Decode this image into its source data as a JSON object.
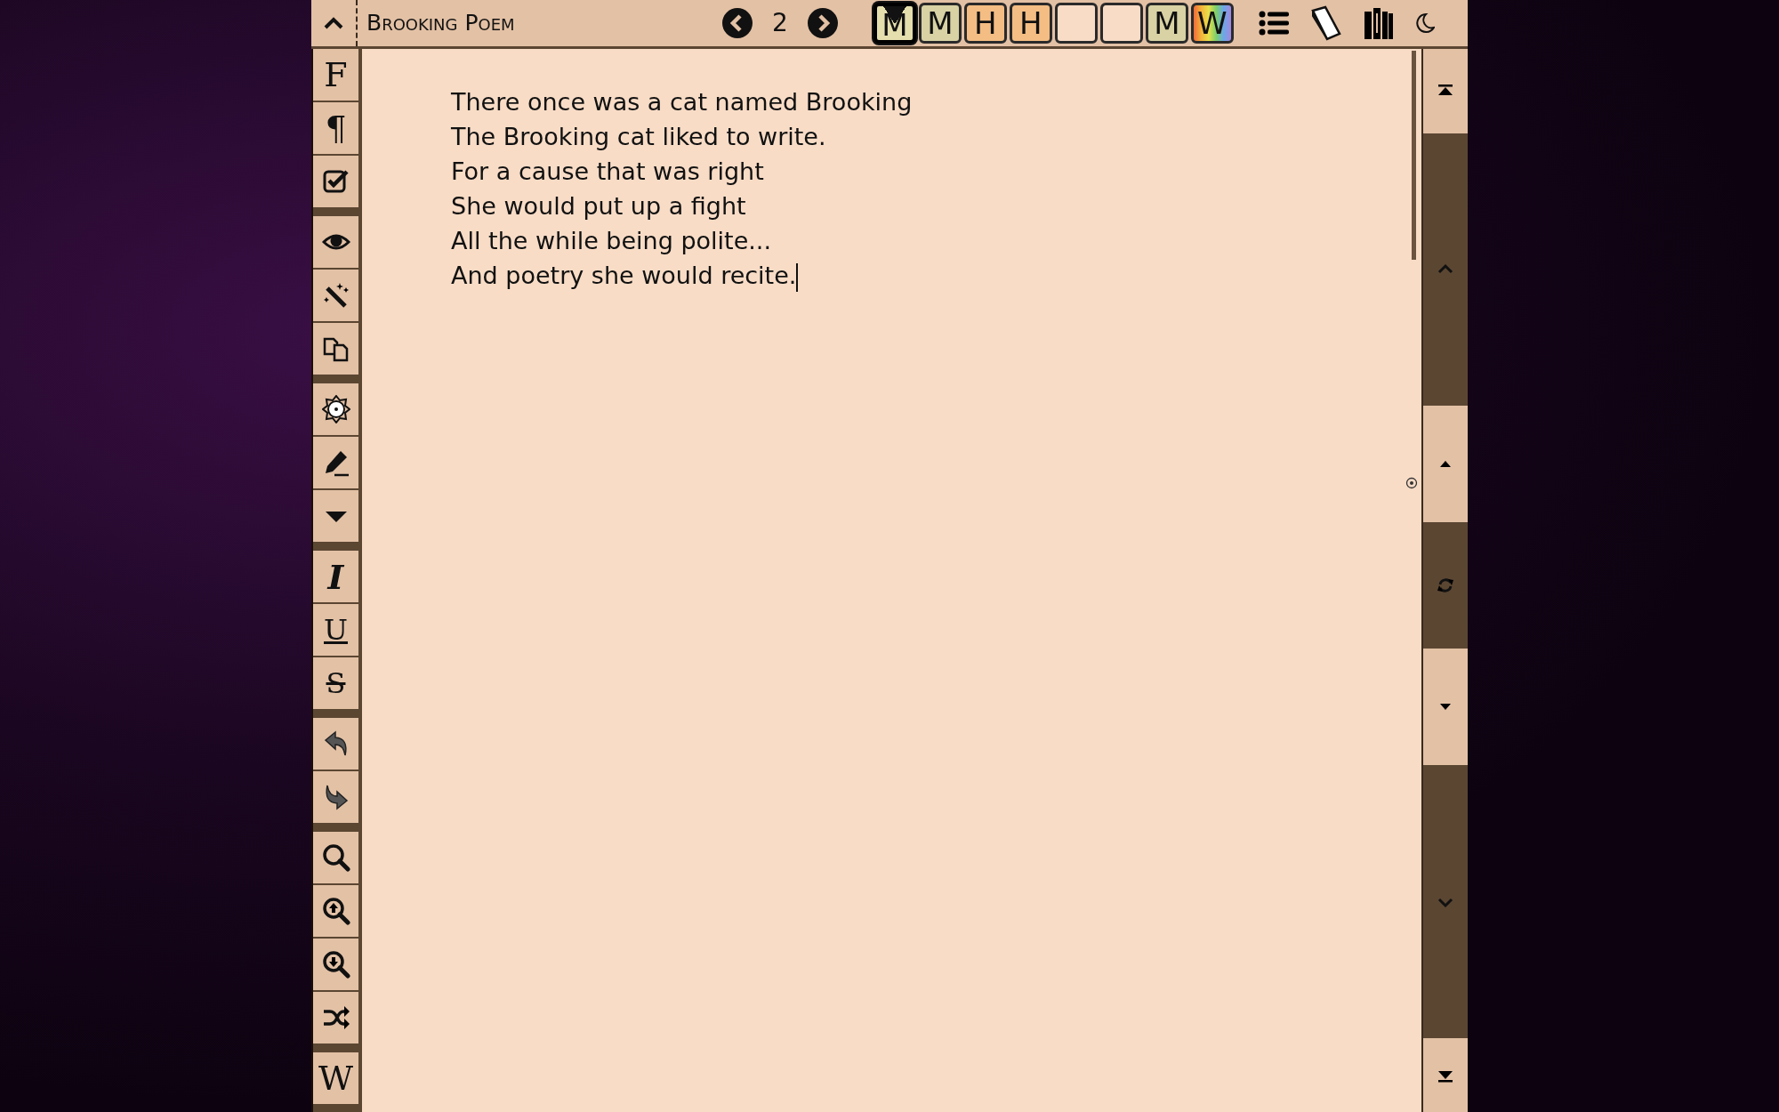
{
  "document": {
    "title": "Brooking Poem",
    "page": "2"
  },
  "level_tiles": [
    {
      "kind": "solid",
      "label": "M",
      "color": "#d8d2a4",
      "selected": true
    },
    {
      "kind": "solid",
      "label": "M",
      "color": "#d8d2a4",
      "selected": false
    },
    {
      "kind": "solid",
      "label": "H",
      "color": "#f4bd83",
      "selected": false
    },
    {
      "kind": "solid",
      "label": "H",
      "color": "#f4bd83",
      "selected": false
    },
    {
      "kind": "solid",
      "color": "#f8dcc6",
      "selected": false
    },
    {
      "kind": "solid",
      "color": "#f8dcc6",
      "selected": false
    },
    {
      "kind": "solid",
      "label": "M",
      "color": "#d8d2a4",
      "selected": false
    },
    {
      "kind": "rainbow",
      "label": "W",
      "selected": false
    }
  ],
  "left_toolbar": [
    {
      "buttons": [
        {
          "kind": "serif",
          "text": "F"
        },
        {
          "kind": "pilcrow",
          "text": "¶"
        },
        {
          "kind": "icon"
        }
      ]
    },
    {
      "buttons": [
        {
          "kind": "icon"
        },
        {
          "kind": "icon"
        },
        {
          "kind": "icon"
        }
      ]
    },
    {
      "buttons": [
        {
          "kind": "icon"
        },
        {
          "kind": "icon"
        },
        {
          "kind": "icon"
        }
      ]
    },
    {
      "buttons": [
        {
          "kind": "italic",
          "text": "I"
        },
        {
          "kind": "underline",
          "text": "U"
        },
        {
          "kind": "strike",
          "text": "S"
        }
      ]
    },
    {
      "buttons": [
        {
          "kind": "icon"
        },
        {
          "kind": "icon"
        }
      ]
    },
    {
      "buttons": [
        {
          "kind": "icon"
        },
        {
          "kind": "icon"
        },
        {
          "kind": "icon"
        },
        {
          "kind": "icon"
        }
      ]
    },
    {
      "buttons": [
        {
          "kind": "serif",
          "text": "W"
        }
      ]
    }
  ],
  "poem_lines": [
    "There once was a cat named Brooking",
    "The Brooking cat liked to write.",
    "For a cause that was right",
    "She would put up a fight",
    "All the while being polite...",
    "And poetry she would recite."
  ]
}
